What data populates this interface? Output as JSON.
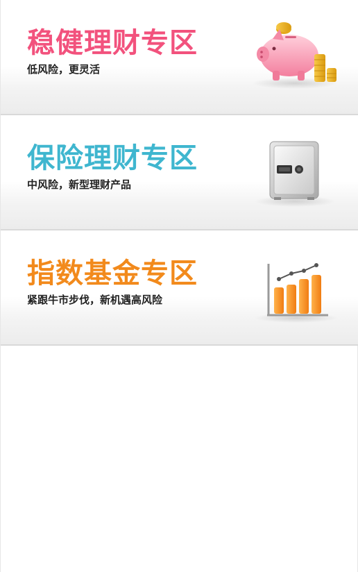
{
  "zones": [
    {
      "title": "稳健理财专区",
      "subtitle": "低风险，更灵活",
      "title_color": "#f2527d",
      "illustration": "piggy-bank-icon"
    },
    {
      "title": "保险理财专区",
      "subtitle": "中风险，新型理财产品",
      "title_color": "#3fb6cf",
      "illustration": "safe-icon"
    },
    {
      "title": "指数基金专区",
      "subtitle": "紧跟牛市步伐，新机遇高风险",
      "title_color": "#f28a1c",
      "illustration": "bar-chart-icon"
    }
  ]
}
